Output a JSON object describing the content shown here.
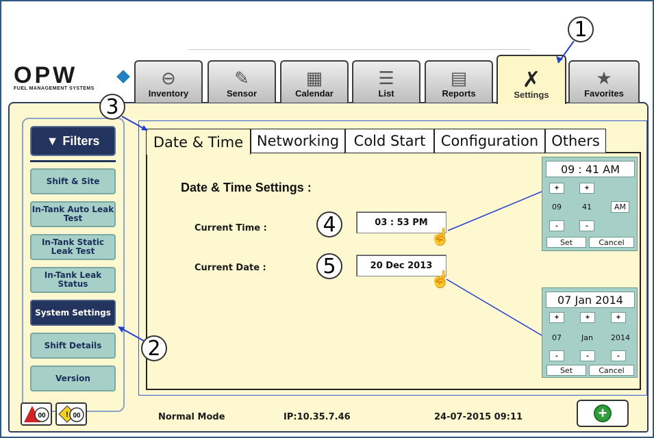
{
  "brand": {
    "name": "OPW",
    "tagline": "FUEL MANAGEMENT SYSTEMS",
    "accent": "#1f7fc1"
  },
  "tabs": [
    {
      "label": "Inventory",
      "icon": "tank-icon"
    },
    {
      "label": "Sensor",
      "icon": "probe-icon"
    },
    {
      "label": "Calendar",
      "icon": "calendar-icon"
    },
    {
      "label": "List",
      "icon": "list-icon"
    },
    {
      "label": "Reports",
      "icon": "reports-icon"
    },
    {
      "label": "Settings",
      "icon": "tools-icon",
      "active": true
    },
    {
      "label": "Favorites",
      "icon": "star-icon"
    }
  ],
  "sidebar": {
    "filters_label": "Filters",
    "items": [
      {
        "label": "Shift & Site"
      },
      {
        "label": "In-Tank Auto Leak Test"
      },
      {
        "label": "In-Tank Static Leak Test"
      },
      {
        "label": "In-Tank Leak Status"
      },
      {
        "label": "System Settings",
        "active": true
      },
      {
        "label": "Shift Details"
      },
      {
        "label": "Version"
      }
    ]
  },
  "subtabs": [
    "Date & Time",
    "Networking",
    "Cold Start",
    "Configuration",
    "Others"
  ],
  "content": {
    "heading": "Date & Time Settings :",
    "current_time_label": "Current Time :",
    "current_time_value": "03 : 53 PM",
    "current_date_label": "Current Date :",
    "current_date_value": "20 Dec 2013"
  },
  "time_picker": {
    "display": "09 : 41 AM",
    "hour": "09",
    "minute": "41",
    "ampm": "AM",
    "plus": "+",
    "minus": "-",
    "set": "Set",
    "cancel": "Cancel"
  },
  "date_picker": {
    "display": "07 Jan 2014",
    "day": "07",
    "month": "Jan",
    "year": "2014",
    "plus": "+",
    "minus": "-",
    "set": "Set",
    "cancel": "Cancel"
  },
  "callouts": [
    "1",
    "2",
    "3",
    "4",
    "5"
  ],
  "status_bar": {
    "alarm_count": "00",
    "warning_count": "00",
    "mode": "Normal Mode",
    "ip": "IP:10.35.7.46",
    "datetime": "24-07-2015 09:11",
    "add_symbol": "+"
  },
  "colors": {
    "panel": "#fdf8d0",
    "sidebar_button": "#a6d0c7",
    "sidebar_active": "#23345e",
    "callout_line": "#1f3fd6"
  }
}
